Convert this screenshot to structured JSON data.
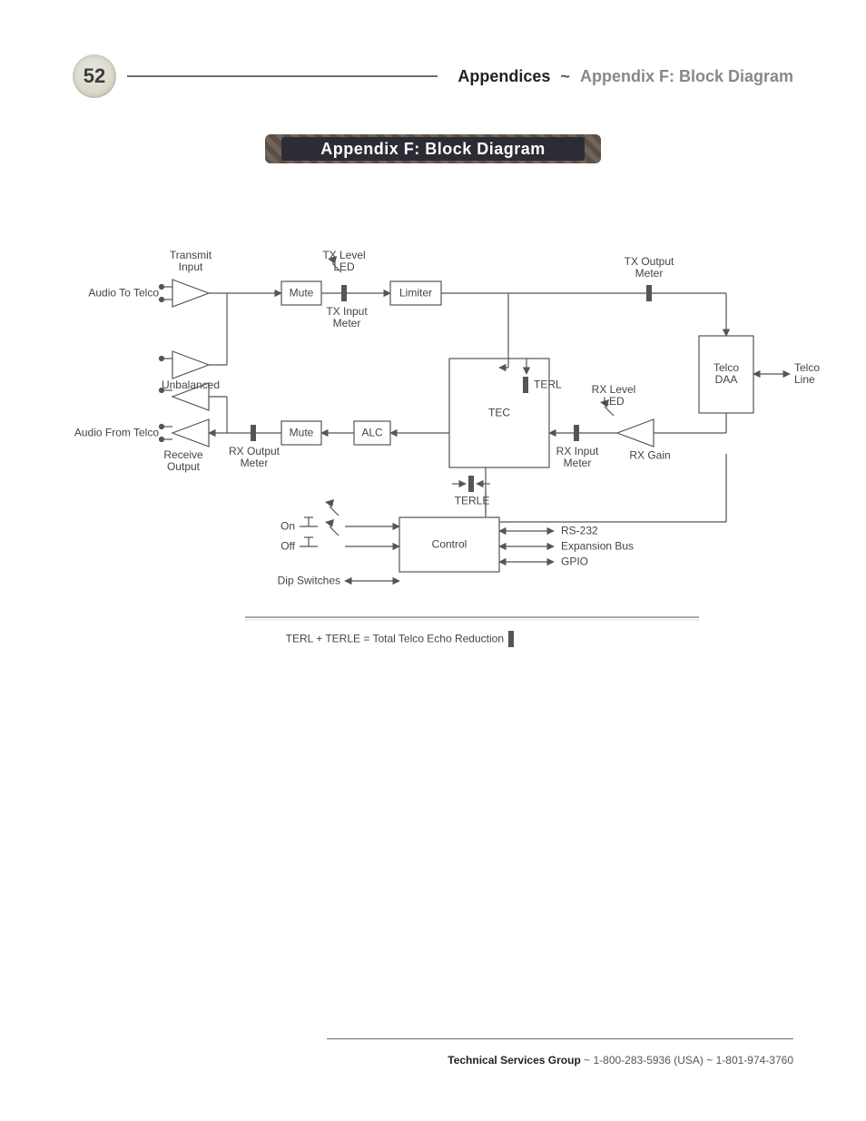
{
  "page_number": "52",
  "header": {
    "part1": "Appendices",
    "separator": "~",
    "part2": "Appendix F: Block Diagram"
  },
  "banner_title": "Appendix F: Block Diagram",
  "diagram": {
    "io_left": {
      "audio_to_telco": "Audio To Telco",
      "audio_from_telco": "Audio From Telco"
    },
    "io_right": {
      "telco_line": "Telco\nLine"
    },
    "labels": {
      "transmit_input": "Transmit\nInput",
      "unbalanced": "Unbalanced",
      "receive_output": "Receive\nOutput",
      "tx_level_led": "TX Level\nLED",
      "tx_input_meter": "TX Input\nMeter",
      "tx_output_meter": "TX Output\nMeter",
      "rx_level_led": "RX Level\nLED",
      "rx_input_meter": "RX Input\nMeter",
      "rx_output_meter": "RX Output\nMeter",
      "rx_gain": "RX Gain",
      "mute_tx": "Mute",
      "mute_rx": "Mute",
      "limiter": "Limiter",
      "alc": "ALC",
      "tec": "TEC",
      "terl": "TERL",
      "terle": "TERLE",
      "telco_daa": "Telco\nDAA",
      "control": "Control",
      "on": "On",
      "off": "Off",
      "dip_switches": "Dip Switches",
      "rs232": "RS-232",
      "exp_bus": "Expansion Bus",
      "gpio": "GPIO"
    },
    "footnote": "TERL + TERLE = Total Telco Echo Reduction"
  },
  "footer": {
    "group": "Technical Services Group",
    "separator": "~",
    "phone_usa": "1-800-283-5936 (USA)",
    "phone_intl": "1-801-974-3760"
  }
}
